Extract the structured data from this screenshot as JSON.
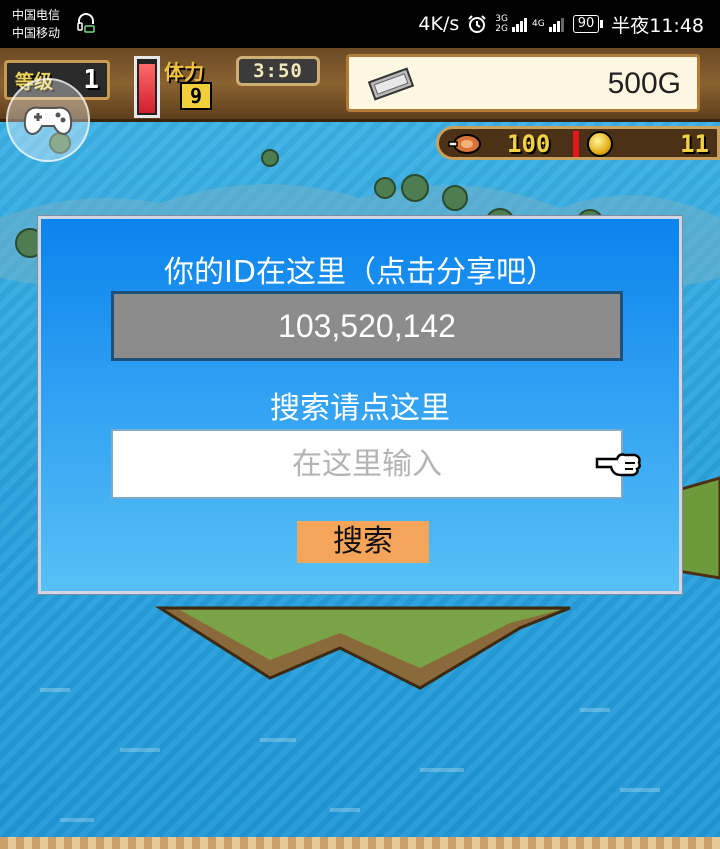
{
  "status_bar": {
    "carrier_1": "中国电信",
    "carrier_2": "中国移动",
    "net_speed": "4K/s",
    "network_1": "3G",
    "network_2": "2G",
    "network_3": "4G",
    "battery": "90",
    "time": "半夜11:48"
  },
  "hud": {
    "level_label": "等级",
    "level_value": "1",
    "stamina_label": "体力",
    "stamina_value": "9",
    "stamina_fill": 0.95,
    "timer": "3:50",
    "money": "500G",
    "food": "100",
    "coins": "11"
  },
  "dialog": {
    "title": "你的ID在这里（点击分享吧）",
    "user_id": "103,520,142",
    "search_hint": "搜索请点这里",
    "search_placeholder": "在这里输入",
    "search_button": "搜索"
  },
  "colors": {
    "dialog_top": "#0a83ee",
    "dialog_bottom": "#56c0f6",
    "id_box": "#8c8c8c",
    "search_button": "#f5a55a"
  },
  "icons": [
    "headset-icon",
    "alarm-icon",
    "signal-icon",
    "gamepad-icon",
    "money-icon",
    "meat-icon",
    "coin-icon",
    "pointer-icon"
  ]
}
